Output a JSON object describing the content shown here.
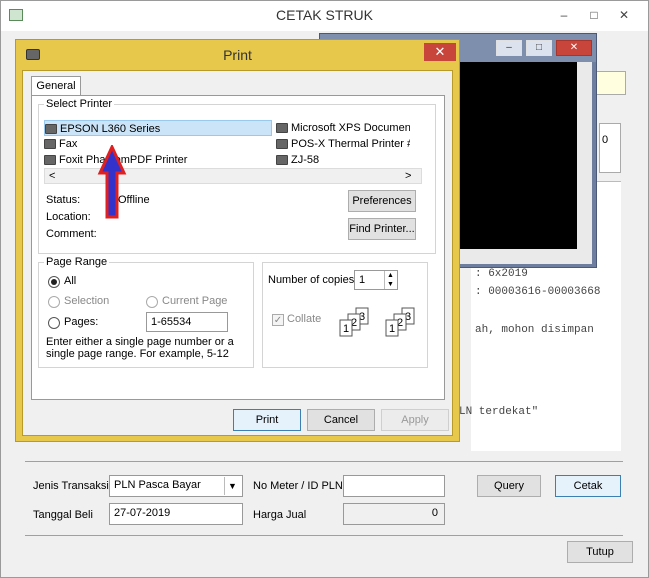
{
  "main": {
    "title": "CETAK STRUK",
    "minimize": "–",
    "maximize": "□",
    "close": "✕",
    "receipt_lines": [
      ": 00003616-00003668",
      "ah, mohon disimpan",
      "LN terdekat\"",
      ": 6x2019"
    ],
    "right_box_text": "0",
    "form": {
      "jenis_label": "Jenis Transaksi",
      "jenis_value": "PLN Pasca Bayar",
      "no_meter_label": "No Meter / ID PLN",
      "no_meter_value": "",
      "query_button": "Query",
      "cetak_button": "Cetak",
      "tanggal_label": "Tanggal Beli",
      "tanggal_value": "27-07-2019",
      "harga_label": "Harga Jual",
      "harga_value": "0",
      "tutup_button": "Tutup"
    }
  },
  "preview": {
    "minimize": "–",
    "maximize": "□",
    "close": "✕"
  },
  "print_dialog": {
    "title": "Print",
    "close": "✕",
    "tab": "General",
    "select_printer_label": "Select Printer",
    "printers_col1": [
      "EPSON L360 Series",
      "Fax",
      "Foxit PhantomPDF Printer"
    ],
    "printers_col2": [
      "Microsoft XPS Document Writer",
      "POS-X Thermal Printer #",
      "ZJ-58"
    ],
    "status_label": "Status:",
    "status_value": "Offline",
    "location_label": "Location:",
    "comment_label": "Comment:",
    "preferences_button": "Preferences",
    "find_printer_button": "Find Printer...",
    "page_range_label": "Page Range",
    "all_label": "All",
    "selection_label": "Selection",
    "current_page_label": "Current Page",
    "pages_label": "Pages:",
    "pages_value": "1-65534",
    "hint": "Enter either a single page number or a single page range.  For example, 5-12",
    "copies_label": "Number of copies:",
    "copies_value": "1",
    "collate_label": "Collate",
    "print_button": "Print",
    "cancel_button": "Cancel",
    "apply_button": "Apply",
    "scroll_left": "<",
    "scroll_right": ">"
  },
  "annotation": {
    "arrow_color": "#3333cc",
    "arrow_outline": "#e02020"
  }
}
